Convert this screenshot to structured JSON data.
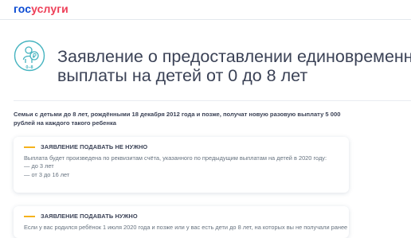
{
  "logo": {
    "part1": "гос",
    "part2": "услуги"
  },
  "hero": {
    "icon_badge_label": "0–8",
    "title_line1": "Заявление о предоставлении единовременной",
    "title_line2": "выплаты на детей от 0 до 8 лет"
  },
  "intro": "Семьи с детьми до 8 лет, рождёнными 18 декабря 2012 года и позже, получат новую разовую выплату 5 000 рублей на каждого такого ребенка",
  "cards": [
    {
      "title": "ЗАЯВЛЕНИЕ ПОДАВАТЬ НЕ НУЖНО",
      "text": "Выплата будет произведена по реквизитам счёта, указанного по предыдущим выплатам на детей в 2020 году:",
      "items": [
        "— до 3 лет",
        "— от 3 до 16 лет"
      ]
    },
    {
      "title": "ЗАЯВЛЕНИЕ ПОДАВАТЬ НУЖНО",
      "text": "Если у вас родился ребёнок 1 июля 2020 года и позже или у вас есть дети до 8 лет, на которых вы не получали ранее"
    }
  ],
  "colors": {
    "brand_blue": "#0d4cd3",
    "brand_red": "#ee3f58",
    "accent_yellow": "#f5b21c",
    "icon_teal": "#44b3bf"
  }
}
